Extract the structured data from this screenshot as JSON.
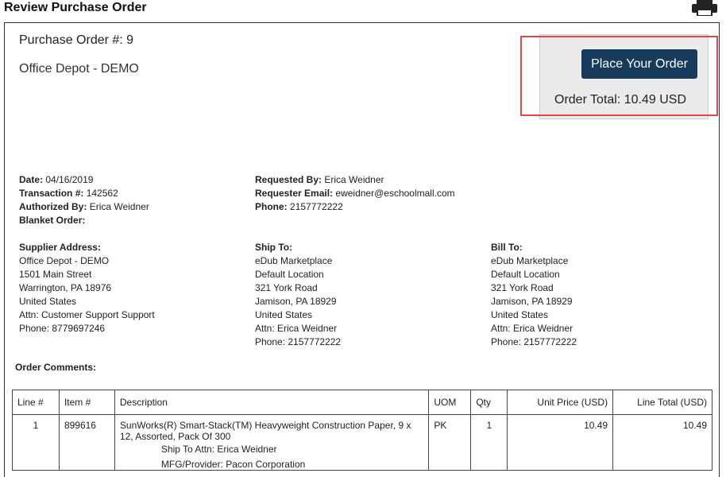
{
  "header": {
    "title": "Review Purchase Order",
    "print_icon": "print-icon"
  },
  "order": {
    "po_label": "Purchase Order #: 9",
    "supplier_name": "Office Depot - DEMO",
    "place_order_label": "Place Your Order",
    "total_label": "Order Total: 10.49 USD"
  },
  "details": {
    "date_label": "Date:",
    "date": "04/16/2019",
    "transaction_label": "Transaction #:",
    "transaction": "142562",
    "authorized_label": "Authorized By:",
    "authorized": "Erica Weidner",
    "blanket_label": "Blanket Order:",
    "requested_label": "Requested By:",
    "requested": "Erica Weidner",
    "email_label": "Requester Email:",
    "email": "eweidner@eschoolmall.com",
    "phone_label": "Phone:",
    "phone": "2157772222"
  },
  "supplier_address": {
    "label": "Supplier Address:",
    "lines": [
      "Office Depot - DEMO",
      "1501 Main Street",
      "Warrington, PA 18976",
      "United States",
      "Attn: Customer Support Support",
      "Phone: 8779697246"
    ]
  },
  "ship_to": {
    "label": "Ship To:",
    "lines": [
      "eDub Marketplace",
      "Default Location",
      "321 York Road",
      "Jamison, PA 18929",
      "United States",
      "Attn: Erica Weidner",
      "Phone: 2157772222"
    ]
  },
  "bill_to": {
    "label": "Bill To:",
    "lines": [
      "eDub Marketplace",
      "Default Location",
      "321 York Road",
      "Jamison, PA 18929",
      "United States",
      "Attn: Erica Weidner",
      "Phone: 2157772222"
    ]
  },
  "comments_label": "Order Comments:",
  "table": {
    "headers": {
      "line": "Line #",
      "item": "Item #",
      "description": "Description",
      "uom": "UOM",
      "qty": "Qty",
      "unit_price": "Unit Price (USD)",
      "line_total": "Line Total (USD)"
    },
    "rows": [
      {
        "line": "1",
        "item": "899616",
        "description": "SunWorks(R) Smart-Stack(TM) Heavyweight Construction Paper, 9 x 12, Assorted, Pack Of 300",
        "ship_to_attn": "Ship To Attn:  Erica Weidner",
        "mfg": "MFG/Provider:  Pacon Corporation",
        "uom": "PK",
        "qty": "1",
        "unit_price": "10.49",
        "line_total": "10.49"
      }
    ]
  }
}
